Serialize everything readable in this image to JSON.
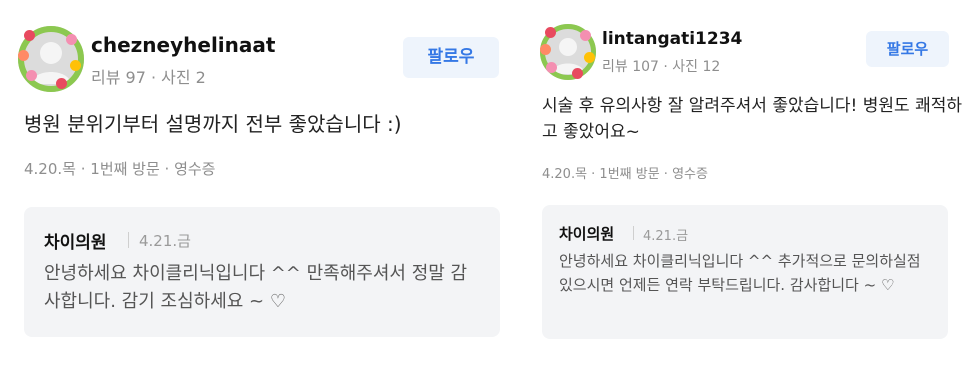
{
  "reviews": [
    {
      "username": "chezneyhelinaat",
      "meta": "리뷰 97 · 사진 2",
      "follow_label": "팔로우",
      "body": "병원 분위기부터 설명까지 전부 좋았습니다 :)",
      "visit": "4.20.목 · 1번째 방문 · 영수증",
      "reply": {
        "owner": "차이의원",
        "date": "4.21.금",
        "text": "안녕하세요 차이클리닉입니다 ^^ 만족해주셔서 정말 감사합니다. 감기 조심하세요 ~ ♡"
      }
    },
    {
      "username": "lintangati1234",
      "meta": "리뷰 107 · 사진 12",
      "follow_label": "팔로우",
      "body": "시술 후 유의사항 잘 알려주셔서 좋았습니다! 병원도 쾌적하고 좋았어요~",
      "visit": "4.20.목 · 1번째 방문 · 영수증",
      "reply": {
        "owner": "차이의원",
        "date": "4.21.금",
        "text": "안녕하세요 차이클리닉입니다 ^^ 추가적으로 문의하실점 있으시면 언제든 연락 부탁드립니다. 감사합니다 ~ ♡"
      }
    }
  ],
  "colors": {
    "follow_text": "#3578e5",
    "follow_bg": "#eef4fc",
    "reply_bg": "#f3f4f6",
    "meta_text": "#8e8e8e"
  }
}
